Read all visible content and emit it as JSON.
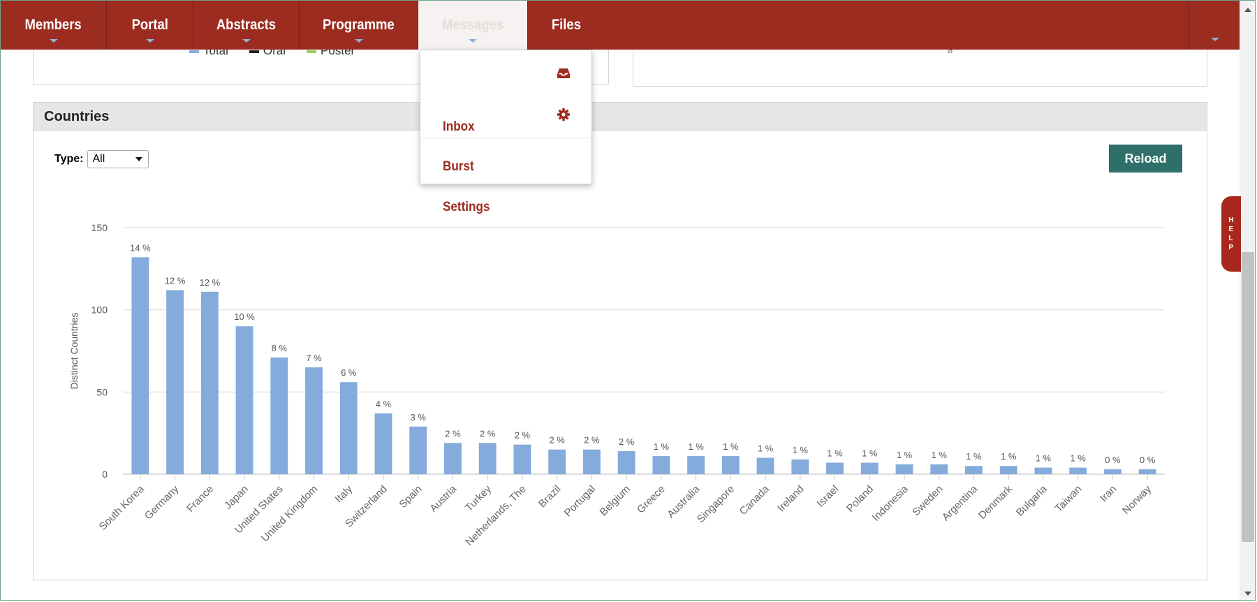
{
  "nav": {
    "items": [
      {
        "label": "Members",
        "has_caret": true
      },
      {
        "label": "Portal",
        "has_caret": true
      },
      {
        "label": "Abstracts",
        "has_caret": true
      },
      {
        "label": "Programme",
        "has_caret": true
      },
      {
        "label": "Messages",
        "has_caret": true,
        "active": true
      },
      {
        "label": "Files",
        "has_caret": false
      }
    ]
  },
  "messages_menu": {
    "items": [
      {
        "label": "Inbox",
        "icon": "inbox-icon"
      },
      {
        "label": "Burst",
        "icon": "gear-icon"
      },
      {
        "label": "Settings",
        "icon": ""
      }
    ]
  },
  "top_panel": {
    "legend": [
      "Total",
      "Oral",
      "Poster"
    ],
    "side_text": "sh"
  },
  "countries_panel": {
    "title": "Countries",
    "type_label": "Type:",
    "type_value": "All",
    "reload_label": "Reload"
  },
  "help_tab": {
    "label": "HELP"
  },
  "colors": {
    "nav_bg": "#9c2b20",
    "bar": "#84abdb",
    "reload_bg": "#2f6f6a",
    "menu_text": "#9c2b20"
  },
  "chart_data": {
    "type": "bar",
    "ylabel": "Distinct Countries",
    "ylim": [
      0,
      150
    ],
    "yticks": [
      0,
      50,
      100,
      150
    ],
    "grid": true,
    "categories": [
      "South Korea",
      "Germany",
      "France",
      "Japan",
      "United States",
      "United Kingdom",
      "Italy",
      "Switzerland",
      "Spain",
      "Austria",
      "Turkey",
      "Netherlands, The",
      "Brazil",
      "Portugal",
      "Belgium",
      "Greece",
      "Australia",
      "Singapore",
      "Canada",
      "Ireland",
      "Israel",
      "Poland",
      "Indonesia",
      "Sweden",
      "Argentina",
      "Denmark",
      "Bulgaria",
      "Taiwan",
      "Iran",
      "Norway"
    ],
    "values": [
      132,
      112,
      111,
      90,
      71,
      65,
      56,
      37,
      29,
      19,
      19,
      18,
      15,
      15,
      14,
      11,
      11,
      11,
      10,
      9,
      7,
      7,
      6,
      6,
      5,
      5,
      4,
      4,
      3,
      3
    ],
    "labels": [
      "14 %",
      "12 %",
      "12 %",
      "10 %",
      "8 %",
      "7 %",
      "6 %",
      "4 %",
      "3 %",
      "2 %",
      "2 %",
      "2 %",
      "2 %",
      "2 %",
      "2 %",
      "1 %",
      "1 %",
      "1 %",
      "1 %",
      "1 %",
      "1 %",
      "1 %",
      "1 %",
      "1 %",
      "1 %",
      "1 %",
      "1 %",
      "1 %",
      "0 %",
      "0 %"
    ]
  }
}
